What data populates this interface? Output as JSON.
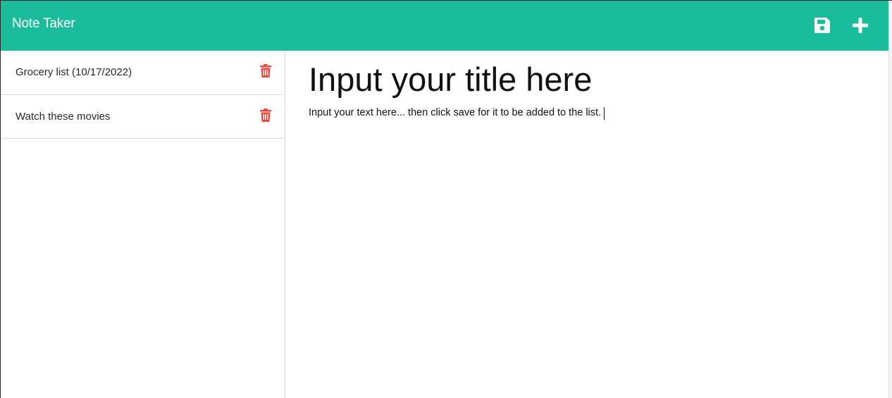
{
  "navbar": {
    "brand": "Note Taker",
    "background": "#1abc9c",
    "actions": [
      {
        "icon": "save-icon",
        "color": "#ffffff"
      },
      {
        "icon": "plus-icon",
        "color": "#ffffff"
      }
    ]
  },
  "sidebar": {
    "notes": [
      {
        "title": "Grocery list (10/17/2022)",
        "delete_icon": "trash-icon",
        "delete_color": "#e74c3c"
      },
      {
        "title": "Watch these movies",
        "delete_icon": "trash-icon",
        "delete_color": "#e74c3c"
      }
    ]
  },
  "editor": {
    "title_placeholder": "Input your title here",
    "text_placeholder": "Input your text here... then click save for it to be added to the list."
  }
}
